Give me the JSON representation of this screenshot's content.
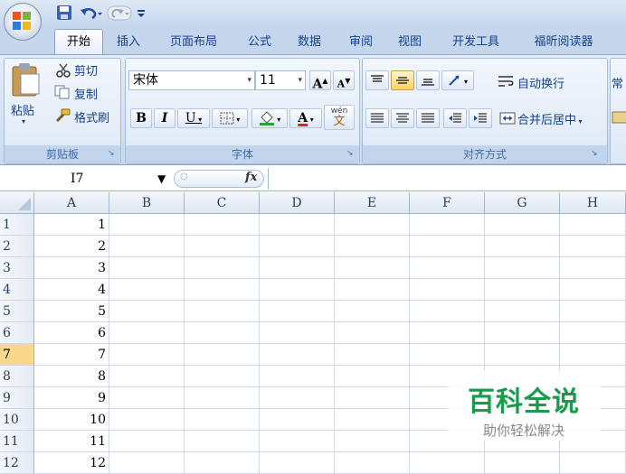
{
  "qat": {
    "save_icon": "save-icon",
    "undo_icon": "undo-icon",
    "redo_icon": "redo-icon",
    "customize_icon": "customize-qat-icon"
  },
  "tabs": [
    "开始",
    "插入",
    "页面布局",
    "公式",
    "数据",
    "审阅",
    "视图",
    "开发工具",
    "福昕阅读器"
  ],
  "clipboard": {
    "paste": "粘贴",
    "cut": "剪切",
    "copy": "复制",
    "format_painter": "格式刷",
    "group": "剪贴板"
  },
  "font": {
    "name": "宋体",
    "size": "11",
    "bold": "B",
    "italic": "I",
    "underline": "U",
    "color_letter": "A",
    "phonetic": "wén",
    "phonetic_char": "文",
    "grow": "A",
    "shrink": "A",
    "group": "字体"
  },
  "alignment": {
    "wrap": "自动换行",
    "merge": "合并后居中",
    "group": "对齐方式"
  },
  "number": {
    "format": "常"
  },
  "formula_bar": {
    "name_box": "I7",
    "fx": "fx"
  },
  "columns": [
    "A",
    "B",
    "C",
    "D",
    "E",
    "F",
    "G",
    "H"
  ],
  "rows": [
    {
      "n": "1",
      "a": "1"
    },
    {
      "n": "2",
      "a": "2"
    },
    {
      "n": "3",
      "a": "3"
    },
    {
      "n": "4",
      "a": "4"
    },
    {
      "n": "5",
      "a": "5"
    },
    {
      "n": "6",
      "a": "6"
    },
    {
      "n": "7",
      "a": "7"
    },
    {
      "n": "8",
      "a": "8"
    },
    {
      "n": "9",
      "a": "9"
    },
    {
      "n": "10",
      "a": "10"
    },
    {
      "n": "11",
      "a": "11"
    },
    {
      "n": "12",
      "a": "12"
    }
  ],
  "selected_row": "7",
  "watermark": {
    "title": "百科全说",
    "subtitle": "助你轻松解决"
  },
  "colors": {
    "accent": "#15428b",
    "selected_header": "#f8d98a",
    "green": "#2f9e3f",
    "red": "#e02020"
  }
}
